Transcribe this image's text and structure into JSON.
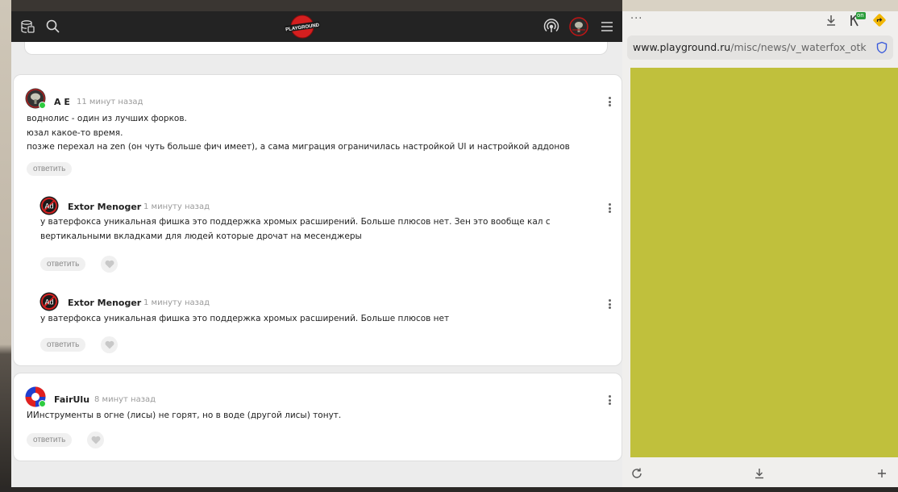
{
  "site": {
    "logo_text": "PLAYGROUND"
  },
  "comments": [
    {
      "author": "A E",
      "time": "11 минут назад",
      "lines": [
        "воднолис - один из лучших форков.",
        "юзал какое-то время.",
        "позже перехал на zen (он чуть больше фич имеет), а сама миграция ограничилась настройкой UI и настройкой аддонов"
      ],
      "reply_label": "ответить"
    },
    {
      "author": "Extor Menoger",
      "time": "1 минуту назад",
      "lines": [
        "у ватерфокса уникальная фишка это поддержка хромых расширений. Больше плюсов нет. Зен это вообще кал с",
        "вертикальными вкладками для людей которые дрочат на месенджеры"
      ],
      "reply_label": "ответить"
    },
    {
      "author": "Extor Menoger",
      "time": "1 минуту назад",
      "lines": [
        "у ватерфокса уникальная фишка это поддержка хромых расширений. Больше плюсов нет"
      ],
      "reply_label": "ответить"
    },
    {
      "author": "FairUlu",
      "time": "8 минут назад",
      "lines": [
        "ИИнструменты в огне (лисы) не горят, но в воде (другой лисы) тонут."
      ],
      "reply_label": "ответить"
    }
  ],
  "right_panel": {
    "menu_dots": "···",
    "url_domain": "www.playground.ru",
    "url_path": "/misc/news/v_waterfox_otk",
    "extension_badge": "on",
    "preview_color": "#c0c03c"
  },
  "colors": {
    "header_bg": "#232323",
    "online": "#2ecc40",
    "preview": "#c0c03c"
  }
}
